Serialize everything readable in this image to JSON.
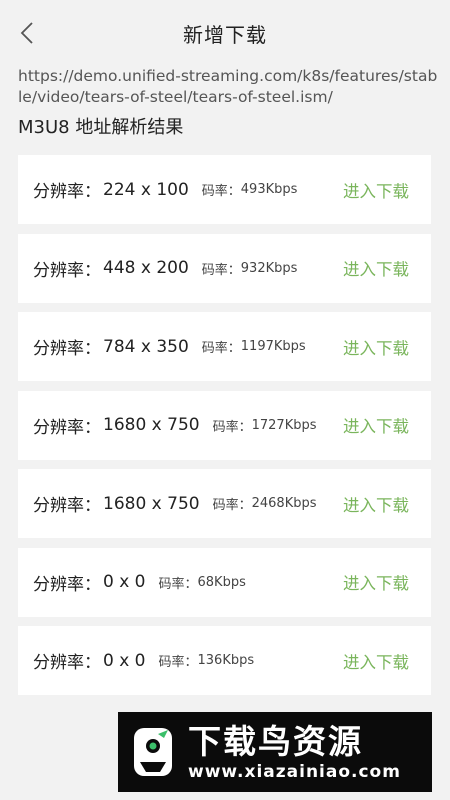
{
  "header": {
    "title": "新增下载"
  },
  "url": "https://demo.unified-streaming.com/k8s/features/stable/video/tears-of-steel/tears-of-steel.ism/",
  "section_title": "M3U8 地址解析结果",
  "resolution_label": "分辨率：",
  "rate_label": "码率：",
  "download_label": "进入下载",
  "items": [
    {
      "resolution": "224 x 100",
      "rate": "493Kbps"
    },
    {
      "resolution": "448 x 200",
      "rate": "932Kbps"
    },
    {
      "resolution": "784 x 350",
      "rate": "1197Kbps"
    },
    {
      "resolution": "1680 x 750",
      "rate": "1727Kbps"
    },
    {
      "resolution": "1680 x 750",
      "rate": "2468Kbps"
    },
    {
      "resolution": "0 x 0",
      "rate": "68Kbps"
    },
    {
      "resolution": "0 x 0",
      "rate": "136Kbps"
    }
  ],
  "watermark": {
    "name": "下载鸟资源",
    "url": "www.xiazainiao.com"
  },
  "colors": {
    "accent": "#7ab55c",
    "background": "#f2f2f2",
    "card": "#ffffff"
  }
}
